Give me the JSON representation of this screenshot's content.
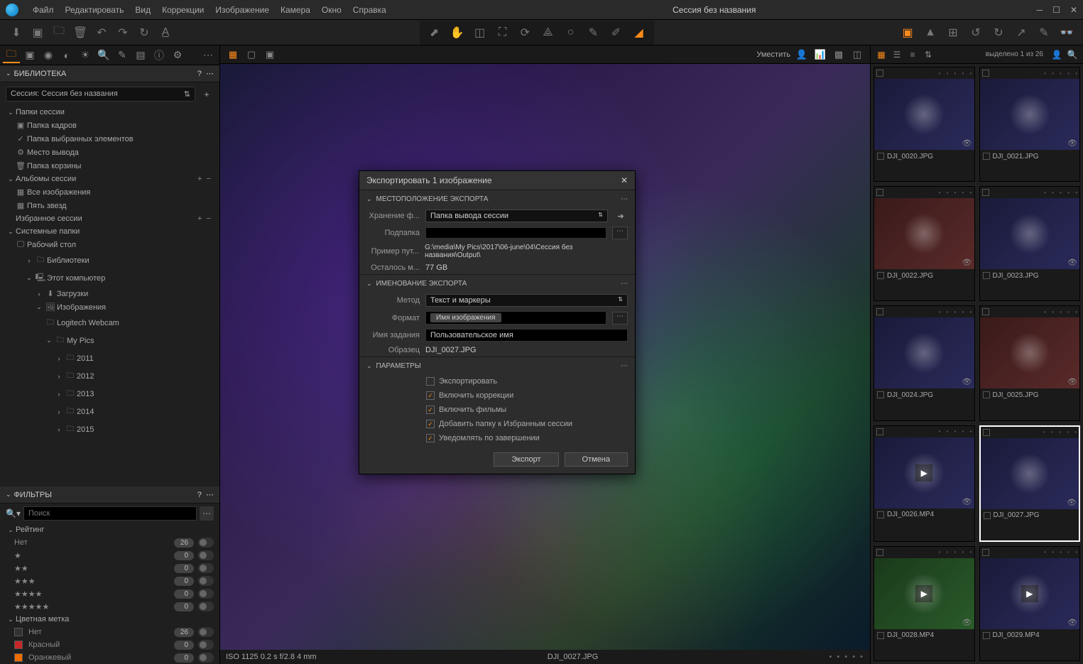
{
  "menu": {
    "file": "Файл",
    "edit": "Редактировать",
    "view": "Вид",
    "corrections": "Коррекции",
    "image": "Изображение",
    "camera": "Камера",
    "window": "Окно",
    "help": "Справка"
  },
  "window_title": "Сессия без названия",
  "viewer_bar": {
    "fit_label": "Уместить"
  },
  "left": {
    "library_header": "БИБЛИОТЕКА",
    "session_prefix": "Сессия:",
    "session_name": "Сессия без названия",
    "session_folders": "Папки сессии",
    "capture_folder": "Папка кадров",
    "selects_folder": "Папка выбранных элементов",
    "output_folder": "Место вывода",
    "trash_folder": "Папка корзины",
    "session_albums": "Альбомы сессии",
    "all_images": "Все изображения",
    "five_stars": "Пять звезд",
    "session_favorites": "Избранное сессии",
    "system_folders": "Системные папки",
    "desktop": "Рабочий стол",
    "libraries": "Библиотеки",
    "this_pc": "Этот компьютер",
    "downloads": "Загрузки",
    "images": "Изображения",
    "logitech": "Logitech Webcam",
    "mypics": "My Pics",
    "y2011": "2011",
    "y2012": "2012",
    "y2013": "2013",
    "y2014": "2014",
    "y2015": "2015",
    "filters_header": "ФИЛЬТРЫ",
    "search_placeholder": "Поиск",
    "rating_label": "Рейтинг",
    "rating_none": "Нет",
    "rating_counts": {
      "none": "26",
      "s1": "0",
      "s2": "0",
      "s3": "0",
      "s4": "0",
      "s5": "0"
    },
    "color_label": "Цветная метка",
    "color_none": "Нет",
    "color_red": "Красный",
    "color_orange": "Оранжевый",
    "color_counts": {
      "none": "26",
      "red": "0",
      "orange": "0"
    }
  },
  "viewer": {
    "iso_info": "ISO 1125 0.2 s f/2.8 4 mm",
    "filename": "DJI_0027.JPG"
  },
  "browser": {
    "selection": "выделено 1 из 26",
    "thumbs": [
      {
        "name": "DJI_0020.JPG",
        "video": false,
        "tint": "blue"
      },
      {
        "name": "DJI_0021.JPG",
        "video": false,
        "tint": "blue"
      },
      {
        "name": "DJI_0022.JPG",
        "video": false,
        "tint": "red"
      },
      {
        "name": "DJI_0023.JPG",
        "video": false,
        "tint": "blue"
      },
      {
        "name": "DJI_0024.JPG",
        "video": false,
        "tint": "blue"
      },
      {
        "name": "DJI_0025.JPG",
        "video": false,
        "tint": "red"
      },
      {
        "name": "DJI_0026.MP4",
        "video": true,
        "tint": "blue"
      },
      {
        "name": "DJI_0027.JPG",
        "video": false,
        "tint": "blue",
        "selected": true
      },
      {
        "name": "DJI_0028.MP4",
        "video": true,
        "tint": "green"
      },
      {
        "name": "DJI_0029.MP4",
        "video": true,
        "tint": "blue"
      }
    ]
  },
  "dialog": {
    "title": "Экспортировать 1 изображение",
    "sec_location": "МЕСТОПОЛОЖЕНИЕ ЭКСПОРТА",
    "storage_label": "Хранение ф...",
    "storage_value": "Папка вывода сессии",
    "subfolder_label": "Подпапка",
    "subfolder_value": "",
    "path_label": "Пример пут...",
    "path_value": "G:\\media\\My Pics\\2017\\06-june\\04\\Сессия без названия\\Output\\",
    "space_label": "Осталось м...",
    "space_value": "77 GB",
    "sec_naming": "ИМЕНОВАНИЕ ЭКСПОРТА",
    "method_label": "Метод",
    "method_value": "Текст и маркеры",
    "format_label": "Формат",
    "format_token": "Имя изображения",
    "jobname_label": "Имя задания",
    "jobname_value": "Пользовательское имя",
    "sample_label": "Образец",
    "sample_value": "DJI_0027.JPG",
    "sec_params": "ПАРАМЕТРЫ",
    "chk_export": "Экспортировать",
    "chk_corrections": "Включить коррекции",
    "chk_movies": "Включить фильмы",
    "chk_favorites": "Добавить папку к Избранным сессии",
    "chk_notify": "Уведомлять по завершении",
    "btn_export": "Экспорт",
    "btn_cancel": "Отмена"
  }
}
